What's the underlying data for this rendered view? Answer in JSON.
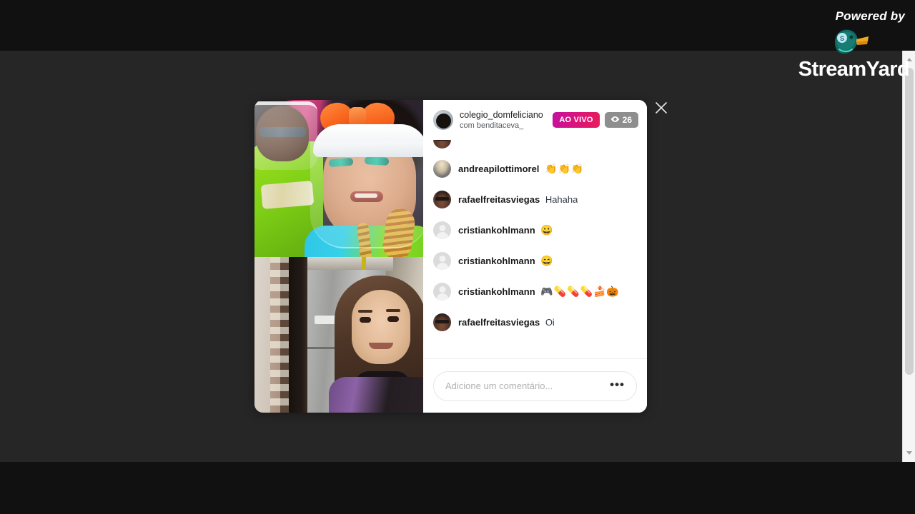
{
  "watermark": {
    "powered_label": "Powered by",
    "brand": "StreamYard",
    "duck_icon": "duck-logo-icon"
  },
  "modal": {
    "close_icon": "close-icon",
    "header": {
      "avatar_icon": "host-avatar",
      "username": "colegio_domfeliciano",
      "with_label": "com benditaceva_",
      "live_badge": "AO VIVO",
      "viewers_count": "26",
      "viewers_icon": "eye-icon"
    },
    "comments": [
      {
        "avatar": "avatar-clipped",
        "username": "",
        "text": "",
        "emoji": "",
        "clipped": true
      },
      {
        "avatar": "avatar-andrea",
        "username": "andreapilottimorel",
        "text": "",
        "emoji": "👏👏👏",
        "clipped": false
      },
      {
        "avatar": "avatar-rafael",
        "username": "rafaelfreitasviegas",
        "text": "Hahaha",
        "emoji": "",
        "clipped": false
      },
      {
        "avatar": "avatar-default",
        "username": "cristiankohlmann",
        "text": "",
        "emoji": "😀",
        "clipped": false
      },
      {
        "avatar": "avatar-default",
        "username": "cristiankohlmann",
        "text": "",
        "emoji": "😄",
        "clipped": false
      },
      {
        "avatar": "avatar-default",
        "username": "cristiankohlmann",
        "text": "",
        "emoji": "🎮💊💊💊🍰🎃",
        "clipped": false
      },
      {
        "avatar": "avatar-rafael",
        "username": "rafaelfreitasviegas",
        "text": "Oi",
        "emoji": "",
        "clipped": false
      }
    ],
    "composer": {
      "placeholder": "Adicione um comentário...",
      "value": "",
      "more_icon": "more-options-icon",
      "more_label": "•••"
    },
    "video": {
      "top_tile_name": "live-host-video-tile",
      "bottom_tile_name": "live-guest-video-tile"
    }
  },
  "scrollbar": {
    "up_icon": "scroll-up-arrow-icon",
    "down_icon": "scroll-down-arrow-icon",
    "thumb_name": "scroll-thumb"
  },
  "colors": {
    "live_badge_start": "#c312a0",
    "live_badge_end": "#e81c5a",
    "viewers_badge": "#8e8e8e",
    "page_background": "#262626",
    "letterbox": "#111111",
    "modal_background": "#ffffff"
  }
}
